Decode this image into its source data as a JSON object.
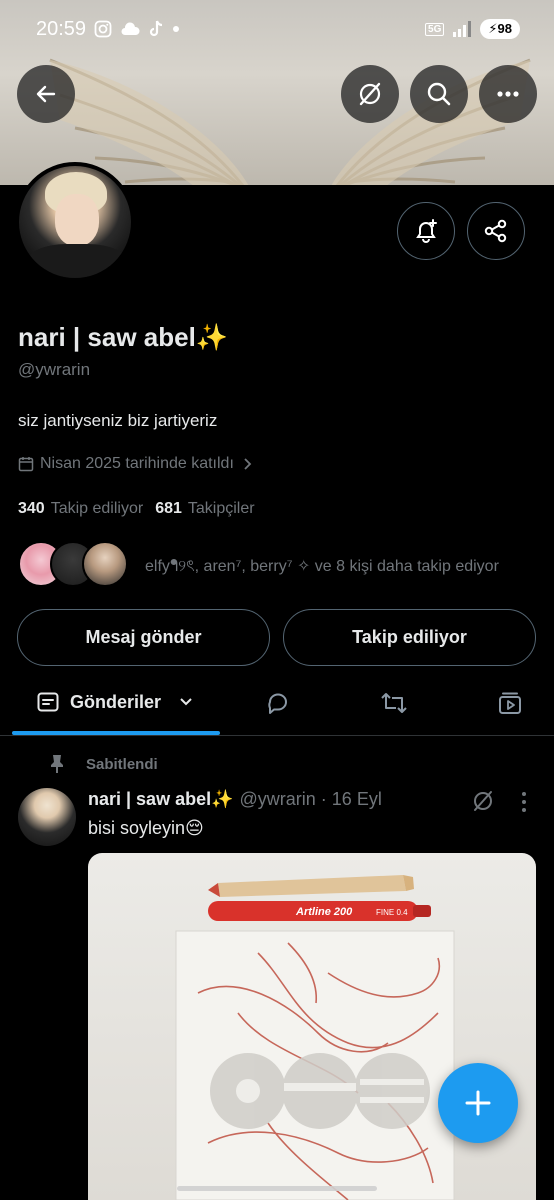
{
  "status_bar": {
    "time": "20:59",
    "network": "5G",
    "battery": "98"
  },
  "profile": {
    "name": "nari | saw abel✨",
    "handle": "@ywrarin",
    "bio": "siz jantiyseniz biz jartiyeriz",
    "joined": "Nisan 2025 tarihinde katıldı",
    "following_count": "340",
    "following_label": "Takip ediliyor",
    "followers_count": "681",
    "followers_label": "Takipçiler",
    "followed_by": "elfyᖳ୨ৎ, aren⁷, berry⁷ ✧ ve 8 kişi daha takip ediyor"
  },
  "buttons": {
    "message": "Mesaj gönder",
    "following": "Takip ediliyor"
  },
  "tabs": {
    "posts": "Gönderiler"
  },
  "post": {
    "pinned_label": "Sabitlendi",
    "author_name": "nari | saw abel✨",
    "meta": "@ywrarin · 16 Eyl",
    "text": "bisi soyleyin😔",
    "image_text_pen": "Artline 200",
    "image_text_fine": "FINE 0.4"
  },
  "icons": {
    "back": "back-arrow-icon",
    "grok": "grok-icon",
    "search": "search-icon",
    "more": "more-horizontal-icon",
    "notify": "bell-plus-icon",
    "share": "share-icon",
    "calendar": "calendar-icon",
    "chevron": "chevron-right-icon",
    "replies": "comment-icon",
    "retweet": "retweet-icon",
    "media": "media-icon",
    "pin": "pin-icon",
    "compose": "plus-icon"
  },
  "colors": {
    "accent": "#1d9bf0",
    "background": "#000000",
    "secondary_text": "#71767b"
  }
}
